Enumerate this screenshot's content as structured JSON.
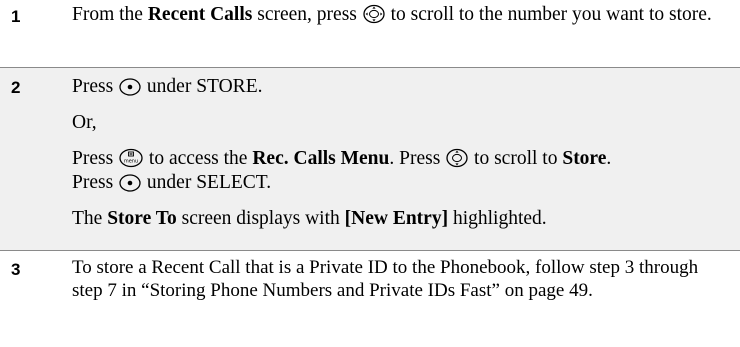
{
  "steps": [
    {
      "number": "1",
      "line_a": "From the ",
      "bold_recent_calls": "Recent Calls",
      "line_b": " screen, press ",
      "line_c": " to scroll to the number you want to store."
    },
    {
      "number": "2",
      "p1_a": "Press ",
      "p1_b": " under STORE.",
      "p2": "Or,",
      "p3_a": "Press ",
      "p3_b": " to access the ",
      "p3_bold_menu": "Rec. Calls Menu",
      "p3_c": ". Press ",
      "p3_d": " to scroll to ",
      "p3_bold_store": "Store",
      "p3_e": ".",
      "p3_f": "Press ",
      "p3_g": " under SELECT.",
      "p4_a": "The ",
      "p4_bold_store_to": "Store To",
      "p4_b": " screen displays with ",
      "p4_bold_new_entry": "[New Entry]",
      "p4_c": " highlighted."
    },
    {
      "number": "3",
      "text": "To store a Recent Call that is a Private ID to the Phonebook, follow step 3 through step 7 in “Storing Phone Numbers and Private IDs Fast” on page 49."
    }
  ],
  "icons": {
    "navigation": "four-way-navigation-key-icon",
    "navigation_updown": "up-down-navigation-key-icon",
    "softkey": "option-key-icon",
    "menu": "menu-key-icon"
  },
  "colors": {
    "shaded_row": "#f0f0f0",
    "rule": "#8a8a8a"
  }
}
